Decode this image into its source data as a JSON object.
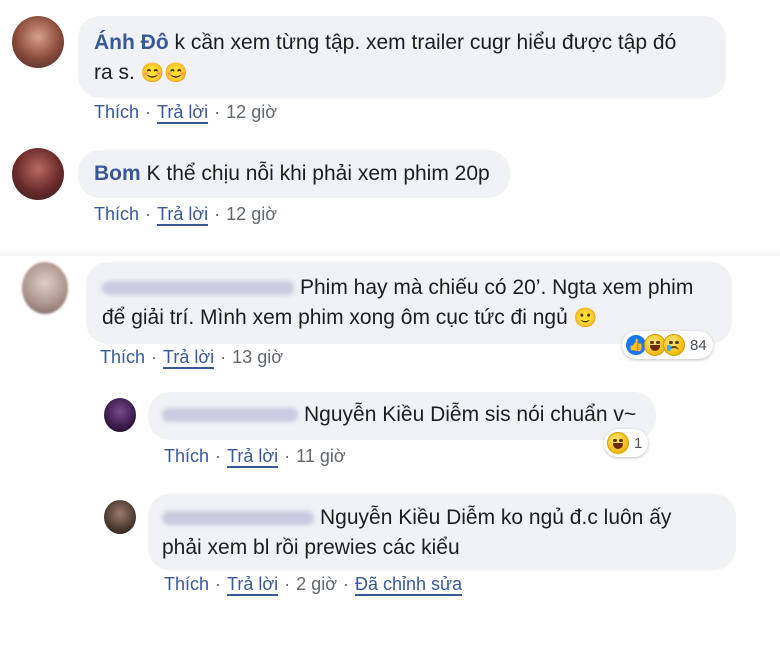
{
  "colors": {
    "author": "#385898",
    "bubble": "#f0f2f5",
    "meta": "#606770"
  },
  "comments": [
    {
      "author": "Ánh Đô",
      "text_line1": "k cần xem từng tập. xem trailer cugr hiểu được tập đó",
      "text_line2": "ra s.",
      "emoji": "😊😊",
      "like": "Thích",
      "reply": "Trả lời",
      "time": "12 giờ"
    },
    {
      "author": "Bom",
      "text_line1": "K thể chịu nỗi khi phải xem phim 20p",
      "like": "Thích",
      "reply": "Trả lời",
      "time": "12 giờ"
    },
    {
      "text_line1": "Phim hay mà chiếu có 20’. Ngta xem phim",
      "text_line2": "để giải trí. Mình xem phim xong ôm cục tức đi ngủ",
      "emoji": "🙂",
      "like": "Thích",
      "reply": "Trả lời",
      "time": "13 giờ",
      "reactions": {
        "icons": [
          "like-icon",
          "laugh-icon",
          "sad-icon"
        ],
        "count": "84"
      }
    }
  ],
  "replies": [
    {
      "text_line1": "Nguyễn Kiều Diễm sis nói chuẩn v~",
      "like": "Thích",
      "reply": "Trả lời",
      "time": "11 giờ",
      "reactions": {
        "icons": [
          "laugh-icon"
        ],
        "count": "1"
      }
    },
    {
      "text_line1": "Nguyễn Kiều Diễm ko ngủ đ.c luôn ấy",
      "text_line2": "phải xem bl rồi prewies các kiểu",
      "like": "Thích",
      "reply": "Trả lời",
      "time": "2 giờ",
      "edited": "Đã chỉnh sửa"
    }
  ]
}
